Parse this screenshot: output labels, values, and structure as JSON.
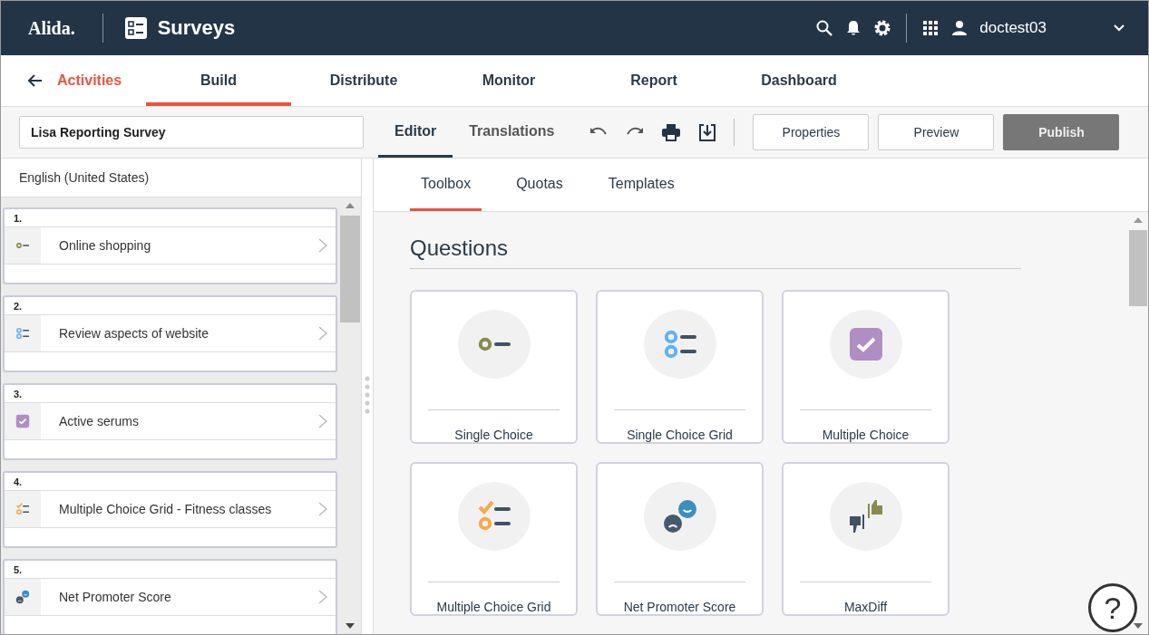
{
  "header": {
    "logo": "Alida.",
    "app_title": "Surveys",
    "user": "doctest03"
  },
  "nav_tabs": [
    {
      "label": "Build",
      "selected": true
    },
    {
      "label": "Distribute",
      "selected": false
    },
    {
      "label": "Monitor",
      "selected": false
    },
    {
      "label": "Report",
      "selected": false
    },
    {
      "label": "Dashboard",
      "selected": false
    }
  ],
  "back_link": "Activities",
  "toolbar": {
    "survey_name": "Lisa Reporting Survey",
    "tabs": [
      {
        "label": "Editor",
        "selected": true
      },
      {
        "label": "Translations",
        "selected": false
      }
    ],
    "buttons": [
      {
        "label": "Properties",
        "disabled": false
      },
      {
        "label": "Preview",
        "disabled": false
      },
      {
        "label": "Publish",
        "disabled": true
      }
    ]
  },
  "language": "English (United States)",
  "questions": [
    {
      "number": "1.",
      "title": "Online shopping",
      "kind": "single"
    },
    {
      "number": "2.",
      "title": "Review aspects of website",
      "kind": "single-grid"
    },
    {
      "number": "3.",
      "title": "Active serums",
      "kind": "multiple"
    },
    {
      "number": "4.",
      "title": "Multiple Choice Grid - Fitness classes",
      "kind": "multiple-grid"
    },
    {
      "number": "5.",
      "title": "Net Promoter Score",
      "kind": "nps"
    }
  ],
  "panel_tabs": [
    {
      "label": "Toolbox",
      "selected": true
    },
    {
      "label": "Quotas",
      "selected": false
    },
    {
      "label": "Templates",
      "selected": false
    }
  ],
  "section_title": "Questions",
  "question_types": [
    {
      "label": "Single Choice",
      "kind": "single"
    },
    {
      "label": "Single Choice Grid",
      "kind": "single-grid"
    },
    {
      "label": "Multiple Choice",
      "kind": "multiple"
    },
    {
      "label": "Multiple Choice Grid",
      "kind": "multiple-grid"
    },
    {
      "label": "Net Promoter Score",
      "kind": "nps"
    },
    {
      "label": "MaxDiff",
      "kind": "maxdiff"
    }
  ],
  "help": "?"
}
